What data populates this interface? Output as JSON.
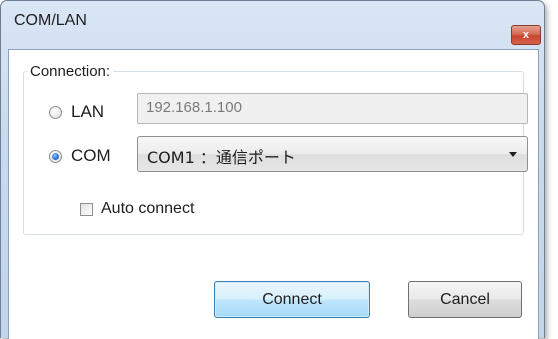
{
  "window": {
    "title": "COM/LAN",
    "close_label": "x"
  },
  "connection": {
    "group_label": "Connection:",
    "lan": {
      "label": "LAN",
      "selected": false,
      "address": "192.168.1.100"
    },
    "com": {
      "label": "COM",
      "selected": true,
      "port_value": "COM1 ：通信ポート"
    },
    "auto_connect": {
      "label": "Auto connect",
      "checked": false
    }
  },
  "buttons": {
    "connect_label": "Connect",
    "cancel_label": "Cancel"
  },
  "colors": {
    "title_bar": "#c9daee",
    "close_button": "#c7442c",
    "default_button_border": "#3c7fb1"
  }
}
